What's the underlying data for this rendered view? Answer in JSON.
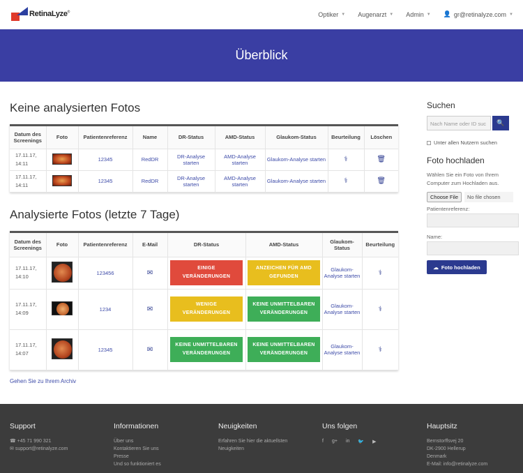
{
  "brand": {
    "name": "RetinaLyze",
    "mark": "®"
  },
  "nav": {
    "items": [
      "Optiker",
      "Augenarzt",
      "Admin"
    ],
    "user": "gr@retinalyze.com"
  },
  "banner": {
    "title": "Überblick"
  },
  "unanalyzed": {
    "title": "Keine analysierten Fotos",
    "headers": [
      "Datum des Screenings",
      "Foto",
      "Patientenreferenz",
      "Name",
      "DR-Status",
      "AMD-Status",
      "Glaukom-Status",
      "Beurteilung",
      "Löschen"
    ],
    "rows": [
      {
        "date": "17.11.17,",
        "time": "14:11",
        "ref": "12345",
        "name": "RedDR",
        "dr": "DR-Analyse starten",
        "amd": "AMD-Analyse starten",
        "glaucoma": "Glaukom-Analyse starten"
      },
      {
        "date": "17.11.17,",
        "time": "14:11",
        "ref": "12345",
        "name": "RedDR",
        "dr": "DR-Analyse starten",
        "amd": "AMD-Analyse starten",
        "glaucoma": "Glaukom-Analyse starten"
      }
    ]
  },
  "analyzed": {
    "title": "Analysierte Fotos (letzte 7 Tage)",
    "headers": [
      "Datum des Screenings",
      "Foto",
      "Patientenreferenz",
      "E-Mail",
      "DR-Status",
      "AMD-Status",
      "Glaukom-Status",
      "Beurteilung"
    ],
    "rows": [
      {
        "date": "17.11.17,",
        "time": "14:10",
        "ref": "123456",
        "dr": "EINIGE VERÄNDERUNGEN",
        "dr_color": "#e04a3c",
        "amd": "ANZEICHEN FÜR AMD GEFUNDEN",
        "amd_color": "#e8be1e",
        "glaucoma": "Glaukom-Analyse starten"
      },
      {
        "date": "17.11.17,",
        "time": "14:09",
        "ref": "1234",
        "dr": "WENIGE VERÄNDERUNGEN",
        "dr_color": "#e8be1e",
        "amd": "KEINE UNMITTELBAREN VERÄNDERUNGEN",
        "amd_color": "#3eae58",
        "glaucoma": "Glaukom-Analyse starten"
      },
      {
        "date": "17.11.17,",
        "time": "14:07",
        "ref": "12345",
        "dr": "KEINE UNMITTELBAREN VERÄNDERUNGEN",
        "dr_color": "#3eae58",
        "amd": "KEINE UNMITTELBAREN VERÄNDERUNGEN",
        "amd_color": "#3eae58",
        "glaucoma": "Glaukom-Analyse starten"
      }
    ],
    "archive_link": "Gehen Sie zu Ihrem Archiv"
  },
  "sidebar": {
    "search_title": "Suchen",
    "search_placeholder": "Nach Name oder ID suc",
    "all_users_label": "Unter allen Nutzern suchen",
    "upload_title": "Foto hochladen",
    "upload_help": "Wählen Sie ein Foto von Ihrem Computer zum Hochladen aus.",
    "choose_file": "Choose File",
    "no_file": "No file chosen",
    "ref_label": "Patientenreferenz:",
    "name_label": "Name:",
    "upload_button": "Foto hochladen"
  },
  "footer": {
    "support": {
      "title": "Support",
      "phone": "+45 71 990 321",
      "email": "support@retinalyze.com"
    },
    "info": {
      "title": "Informationen",
      "links": [
        "Über uns",
        "Kontaktieren Sie uns",
        "Presse",
        "Und so funktioniert es"
      ]
    },
    "news": {
      "title": "Neuigkeiten",
      "line1": "Erfahren Sie hier die aktuellsten",
      "line2": "Neuigkeiten"
    },
    "follow": {
      "title": "Uns folgen"
    },
    "hq": {
      "title": "Hauptsitz",
      "lines": [
        "Bernstorffsvej 20",
        "DK-2900 Hellerup",
        "Denmark",
        "E-Mail: info@retinalyze.com"
      ]
    }
  },
  "colors": {
    "brand_blue": "#3a3ea3",
    "red": "#e04a3c",
    "yellow": "#e8be1e",
    "green": "#3eae58",
    "footer": "#3c3c3c"
  }
}
